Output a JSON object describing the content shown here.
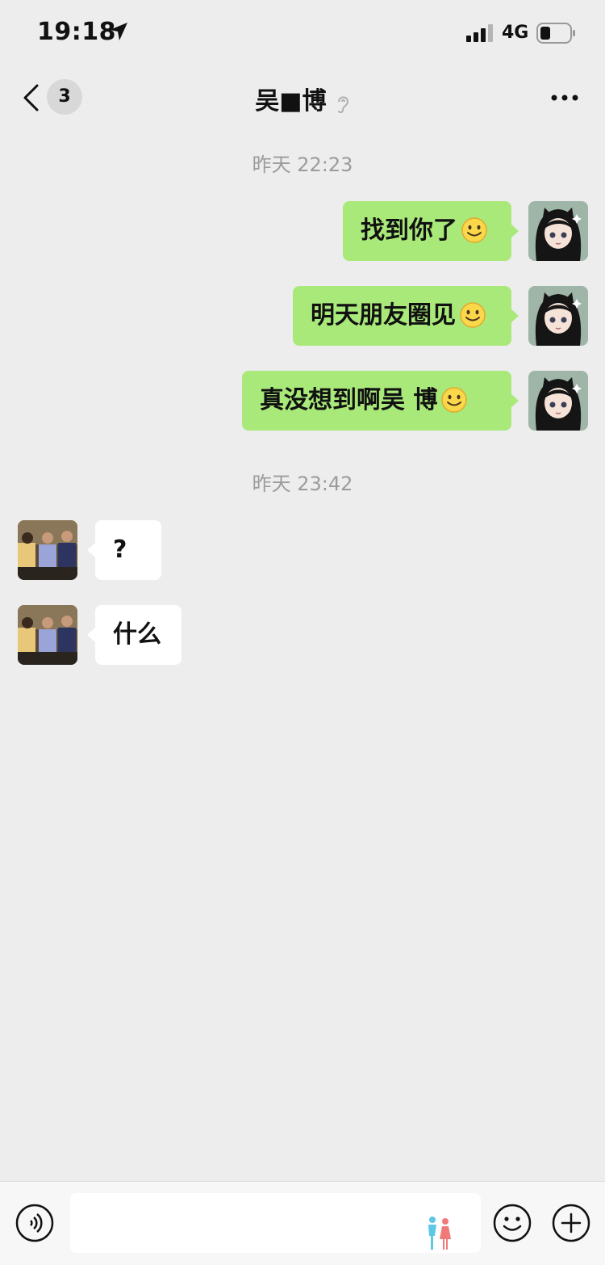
{
  "status_bar": {
    "time": "19:18",
    "network": "4G"
  },
  "nav": {
    "unread_count": "3",
    "title": "吴■博"
  },
  "chat": {
    "timestamps": [
      "昨天 22:23",
      "昨天 23:42"
    ],
    "sent_messages": [
      {
        "text": "找到你了",
        "emoji": "smile-emoji"
      },
      {
        "text": "明天朋友圈见",
        "emoji": "smile-emoji"
      },
      {
        "text": "真没想到啊吴 博",
        "emoji": "smile-emoji"
      }
    ],
    "received_messages": [
      {
        "text": "?"
      },
      {
        "text": "什么"
      }
    ]
  },
  "colors": {
    "sent_bubble": "#a9e97a",
    "received_bubble": "#ffffff",
    "background": "#ededed",
    "timestamp": "#9b9b9b"
  }
}
